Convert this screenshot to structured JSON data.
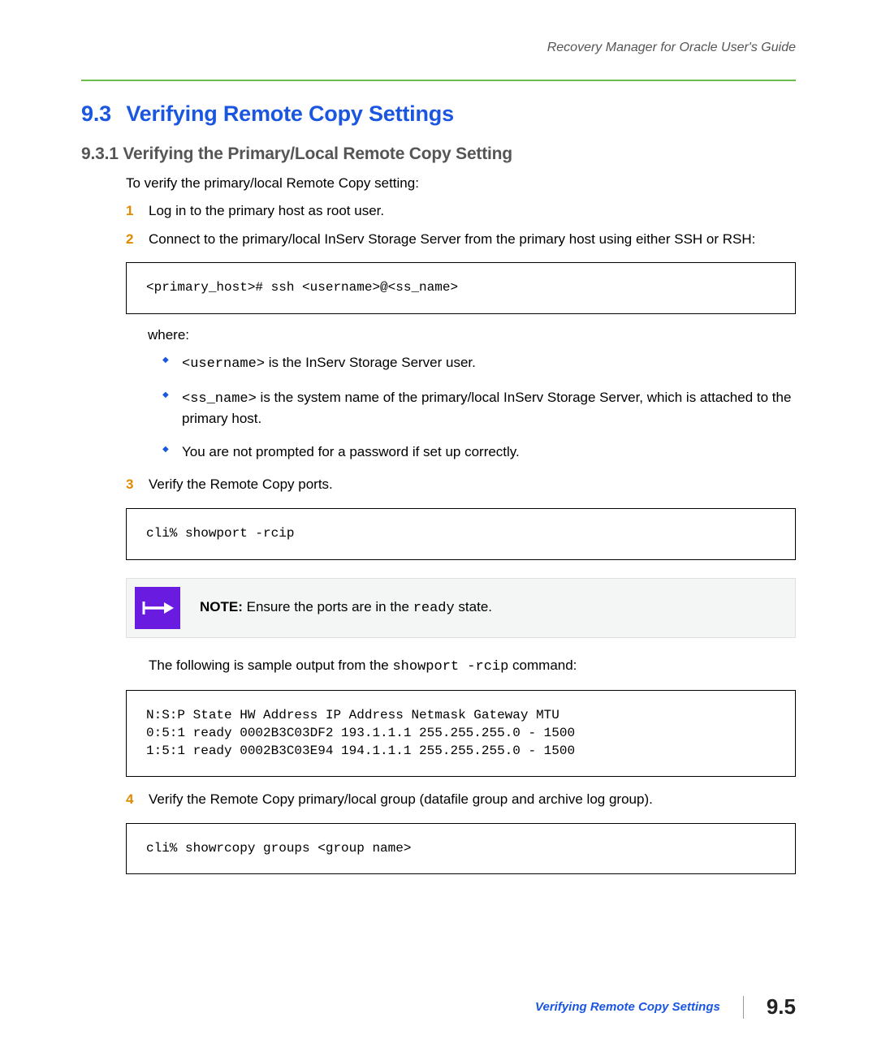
{
  "header": {
    "doc_title": "Recovery Manager for Oracle User's Guide"
  },
  "section": {
    "number": "9.3",
    "title": "Verifying Remote Copy Settings"
  },
  "subsection": {
    "number": "9.3.1",
    "title": "Verifying the Primary/Local Remote Copy Setting"
  },
  "intro": "To verify the primary/local Remote Copy setting:",
  "steps": {
    "s1": {
      "n": "1",
      "text": "Log in to the primary host as root user."
    },
    "s2": {
      "n": "2",
      "text": "Connect to the primary/local InServ Storage Server from the primary host using either SSH or RSH:"
    },
    "s3": {
      "n": "3",
      "text": "Verify the Remote Copy ports."
    },
    "s4": {
      "n": "4",
      "text": "Verify the Remote Copy primary/local group (datafile group and archive log group)."
    }
  },
  "code": {
    "ssh": "<primary_host># ssh <username>@<ss_name>",
    "showport": "cli% showport -rcip",
    "showport_output": "N:S:P State HW Address IP Address Netmask Gateway MTU\n0:5:1 ready 0002B3C03DF2 193.1.1.1 255.255.255.0 - 1500\n1:5:1 ready 0002B3C03E94 194.1.1.1 255.255.255.0 - 1500",
    "showrcopy": "cli% showrcopy groups <group name>"
  },
  "where_label": "where:",
  "where": {
    "b1_code": "<username>",
    "b1_rest": " is the InServ Storage Server user.",
    "b2_code": "<ss_name>",
    "b2_rest": " is the system name of the primary/local InServ Storage Server, which is attached to the primary host.",
    "b3": "You are not prompted for a password if set up correctly."
  },
  "note": {
    "label": "NOTE:",
    "pre": " Ensure the ports are in the ",
    "code": "ready",
    "post": " state."
  },
  "sample": {
    "pre": "The following is sample output from the ",
    "code": "showport -rcip",
    "post": " command:"
  },
  "footer": {
    "title": "Verifying Remote Copy Settings",
    "page": "9.5"
  }
}
